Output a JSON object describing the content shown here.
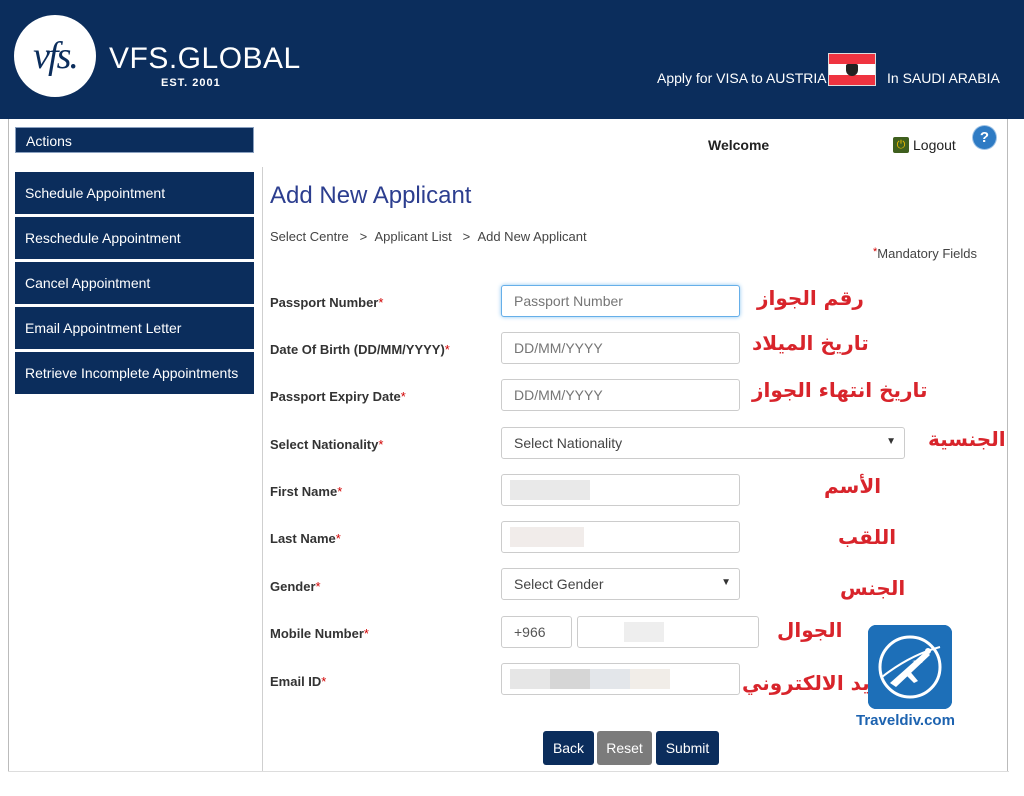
{
  "header": {
    "logo_mark": "vfs.",
    "logo_name": "VFS.GLOBAL",
    "logo_est": "EST. 2001",
    "apply_text": "Apply for VISA to AUSTRIA",
    "in_text": "In SAUDI ARABIA"
  },
  "sidebar": {
    "title": "Actions",
    "items": [
      {
        "label": "Schedule Appointment"
      },
      {
        "label": "Reschedule Appointment"
      },
      {
        "label": "Cancel Appointment"
      },
      {
        "label": "Email Appointment Letter"
      },
      {
        "label": "Retrieve Incomplete Appointments"
      }
    ]
  },
  "topbar": {
    "welcome": "Welcome",
    "logout": "Logout",
    "help": "?"
  },
  "main": {
    "title": "Add New Applicant",
    "breadcrumb": [
      "Select Centre",
      ">",
      "Applicant List",
      ">",
      "Add New Applicant"
    ],
    "mandatory_star": "*",
    "mandatory_text": "Mandatory Fields"
  },
  "form": {
    "required_mark": "*",
    "passport_number": {
      "label": "Passport Number",
      "placeholder": "Passport Number",
      "arabic": "رقم الجواز"
    },
    "dob": {
      "label": "Date Of Birth (DD/MM/YYYY)",
      "placeholder": "DD/MM/YYYY",
      "arabic": "تاريخ الميلاد"
    },
    "passport_expiry": {
      "label": "Passport Expiry Date",
      "placeholder": "DD/MM/YYYY",
      "arabic": "تاريخ انتهاء الجواز"
    },
    "nationality": {
      "label": "Select Nationality",
      "value": "Select Nationality",
      "arabic": "الجنسية"
    },
    "first_name": {
      "label": "First Name",
      "arabic": "الأسم"
    },
    "last_name": {
      "label": "Last Name",
      "arabic": "اللقب"
    },
    "gender": {
      "label": "Gender",
      "value": "Select Gender",
      "arabic": "الجنس"
    },
    "mobile": {
      "label": "Mobile Number",
      "code": "+966",
      "arabic": "الجوال"
    },
    "email": {
      "label": "Email ID",
      "arabic": "البريد الالكتروني"
    }
  },
  "buttons": {
    "back": "Back",
    "reset": "Reset",
    "submit": "Submit"
  },
  "watermark": {
    "text": "Traveldiv.com"
  },
  "colors": {
    "navy": "#0b2d5c",
    "required_red": "#d10000",
    "arabic_red": "#d8242b",
    "title_blue": "#2c3e8f"
  }
}
